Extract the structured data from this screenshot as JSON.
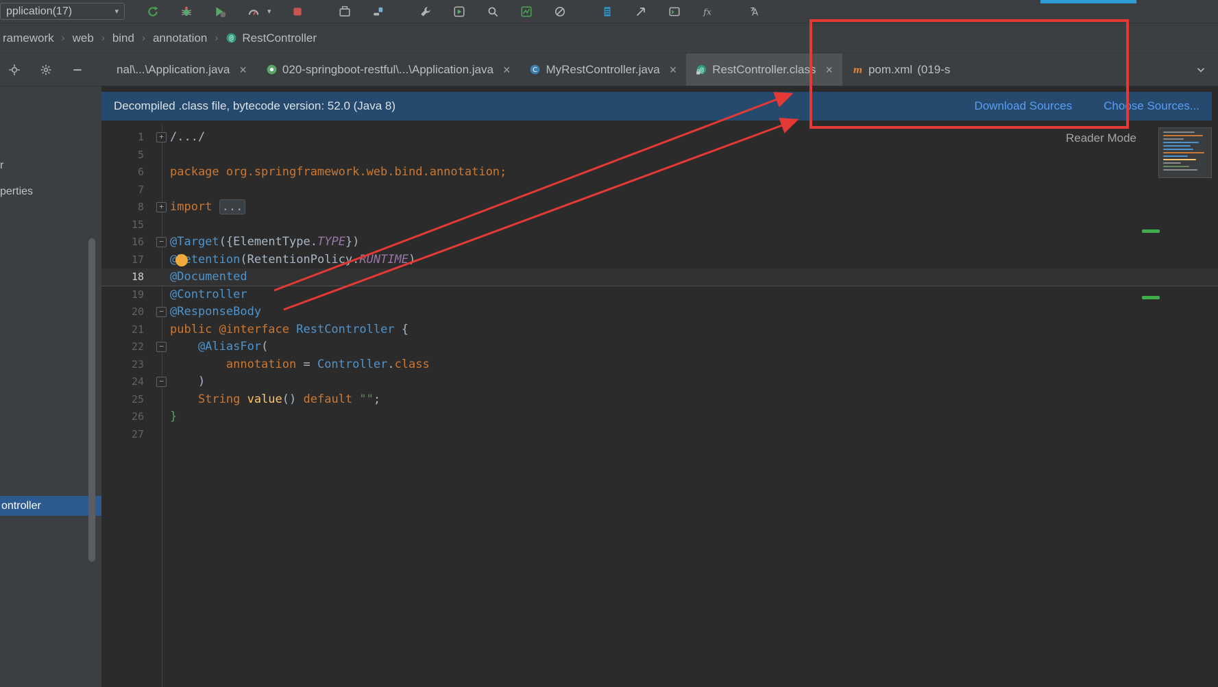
{
  "ui": {
    "close_glyph": "×",
    "breadcrumb_separator": "›",
    "dropdown_caret": "▾",
    "fold_plus": "+",
    "fold_minus": "−"
  },
  "colors": {
    "accent_red": "#e53935",
    "link_blue": "#5a9df6",
    "banner_bg": "#254a6d",
    "selection_blue": "#2d5b8f",
    "keyword_orange": "#cc7832",
    "annotation_blue": "#4e94ce",
    "static_purple": "#9876aa",
    "string_green": "#6a8759",
    "change_marker_green": "#3fae4a",
    "bulb_yellow": "#f2a93c"
  },
  "topbar": {
    "run_config_label": "pplication(17)",
    "icons": [
      "rerun-icon",
      "debug-icon",
      "coverage-icon",
      "profiler-icon",
      "stop-icon",
      "modules-icon",
      "build-icon",
      "wrench-icon",
      "run-anything-icon",
      "search-icon",
      "monitor-icon",
      "inspections-off-icon",
      "database-icon",
      "commit-icon",
      "console-icon",
      "function-icon",
      "translate-icon"
    ]
  },
  "breadcrumbs": {
    "items": [
      {
        "label": "ramework"
      },
      {
        "label": "web"
      },
      {
        "label": "bind"
      },
      {
        "label": "annotation"
      },
      {
        "label": "RestController",
        "icon": "annotation-icon"
      }
    ]
  },
  "panel_toolbar": {
    "icons": [
      "locate-icon",
      "gear-icon",
      "hide-icon"
    ]
  },
  "tabs": {
    "items": [
      {
        "label": "nal\\...\\Application.java",
        "closable": true,
        "selected": false
      },
      {
        "label": "020-springboot-restful\\...\\Application.java",
        "icon": "spring-boot-icon",
        "closable": true,
        "selected": false
      },
      {
        "label": "MyRestController.java",
        "icon": "class-icon",
        "closable": true,
        "selected": false
      },
      {
        "label": "RestController.class",
        "icon": "annotation-lock-icon",
        "closable": true,
        "selected": true
      },
      {
        "label": "pom.xml",
        "suffix": "(019-s",
        "icon": "maven-icon",
        "closable": false,
        "selected": false
      }
    ]
  },
  "banner": {
    "message": "Decompiled .class file, bytecode version: 52.0 (Java 8)",
    "links": [
      {
        "label": "Download Sources"
      },
      {
        "label": "Choose Sources..."
      }
    ]
  },
  "editor": {
    "reader_mode_label": "Reader Mode",
    "lines": [
      {
        "num": "1",
        "fold": "plus",
        "tokens": [
          {
            "t": "/.../",
            "c": "plain"
          }
        ]
      },
      {
        "num": "5",
        "tokens": []
      },
      {
        "num": "6",
        "tokens": [
          {
            "t": "package org.springframework.web.bind.annotation;",
            "c": "kw"
          }
        ]
      },
      {
        "num": "7",
        "tokens": []
      },
      {
        "num": "8",
        "fold": "plus",
        "tokens": [
          {
            "t": "import ",
            "c": "kw"
          },
          {
            "t": "...",
            "c": "fold"
          }
        ]
      },
      {
        "num": "15",
        "tokens": []
      },
      {
        "num": "16",
        "fold": "minus",
        "tokens": [
          {
            "t": "@Target",
            "c": "ann"
          },
          {
            "t": "({",
            "c": "plain"
          },
          {
            "t": "ElementType",
            "c": "plain"
          },
          {
            "t": ".",
            "c": "plain"
          },
          {
            "t": "TYPE",
            "c": "static"
          },
          {
            "t": "})",
            "c": "plain"
          }
        ]
      },
      {
        "num": "17",
        "bulb": true,
        "tokens": [
          {
            "t": "@Retention",
            "c": "ann"
          },
          {
            "t": "(",
            "c": "plain"
          },
          {
            "t": "RetentionPolicy",
            "c": "plain"
          },
          {
            "t": ".",
            "c": "plain"
          },
          {
            "t": "RUNTIME",
            "c": "static"
          },
          {
            "t": ")",
            "c": "plain"
          }
        ]
      },
      {
        "num": "18",
        "caret": true,
        "tokens": [
          {
            "t": "@Documented",
            "c": "ann"
          }
        ]
      },
      {
        "num": "19",
        "tokens": [
          {
            "t": "@Controller",
            "c": "ann"
          }
        ]
      },
      {
        "num": "20",
        "fold": "end",
        "tokens": [
          {
            "t": "@ResponseBody",
            "c": "ann"
          }
        ]
      },
      {
        "num": "21",
        "tokens": [
          {
            "t": "public ",
            "c": "kw"
          },
          {
            "t": "@interface ",
            "c": "kw"
          },
          {
            "t": "RestController ",
            "c": "ann"
          },
          {
            "t": "{",
            "c": "plain"
          }
        ]
      },
      {
        "num": "22",
        "fold": "minus",
        "tokens": [
          {
            "t": "    @AliasFor",
            "c": "ann"
          },
          {
            "t": "(",
            "c": "plain"
          }
        ]
      },
      {
        "num": "23",
        "tokens": [
          {
            "t": "        annotation",
            "c": "kw"
          },
          {
            "t": " = ",
            "c": "plain"
          },
          {
            "t": "Controller",
            "c": "ann"
          },
          {
            "t": ".",
            "c": "plain"
          },
          {
            "t": "class",
            "c": "kw"
          }
        ]
      },
      {
        "num": "24",
        "fold": "end",
        "tokens": [
          {
            "t": "    )",
            "c": "plain"
          }
        ]
      },
      {
        "num": "25",
        "tokens": [
          {
            "t": "    String ",
            "c": "kw"
          },
          {
            "t": "value",
            "c": "method"
          },
          {
            "t": "() ",
            "c": "plain"
          },
          {
            "t": "default ",
            "c": "kw"
          },
          {
            "t": "\"\"",
            "c": "str"
          },
          {
            "t": ";",
            "c": "plain"
          }
        ]
      },
      {
        "num": "26",
        "tokens": [
          {
            "t": "}",
            "c": "grn"
          }
        ]
      },
      {
        "num": "27",
        "tokens": []
      }
    ]
  },
  "project_panel": {
    "clipped_items": [
      {
        "label": "r"
      },
      {
        "label": "perties"
      }
    ],
    "selected_item": "ontroller"
  }
}
